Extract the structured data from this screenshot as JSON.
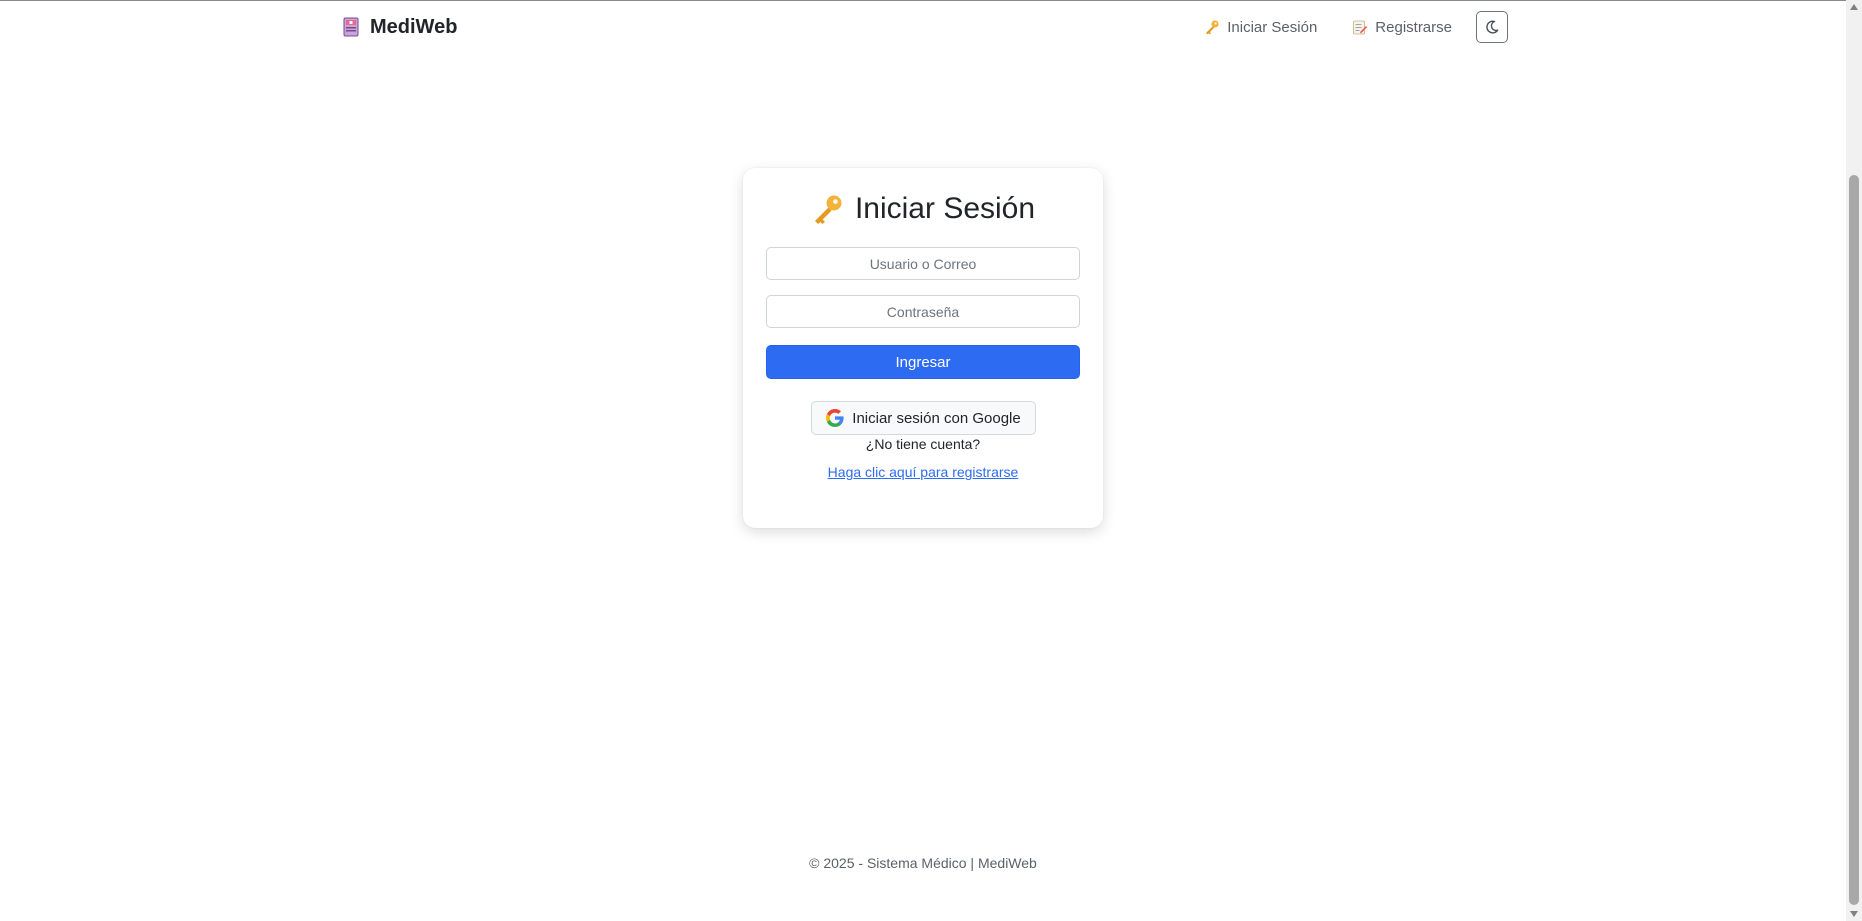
{
  "navbar": {
    "brand_label": "MediWeb",
    "brand_icon": "medical-binder-icon",
    "login_label": "Iniciar Sesión",
    "login_icon": "key-icon",
    "register_label": "Registrarse",
    "register_icon": "memo-icon",
    "theme_toggle_icon": "moon-icon"
  },
  "login_card": {
    "title": "Iniciar Sesión",
    "title_icon": "key-icon",
    "username_placeholder": "Usuario o Correo",
    "username_value": "",
    "password_placeholder": "Contraseña",
    "password_value": "",
    "submit_label": "Ingresar",
    "google_label": "Iniciar sesión con Google",
    "google_icon": "google-icon",
    "no_account_text": "¿No tiene cuenta?",
    "register_link_text": "Haga clic aquí para registrarse"
  },
  "footer": {
    "text": "© 2025 - Sistema Médico | MediWeb"
  },
  "colors": {
    "primary": "#2d6cf2",
    "key_icon": "#f3b23a",
    "text_muted": "#5b6168"
  }
}
